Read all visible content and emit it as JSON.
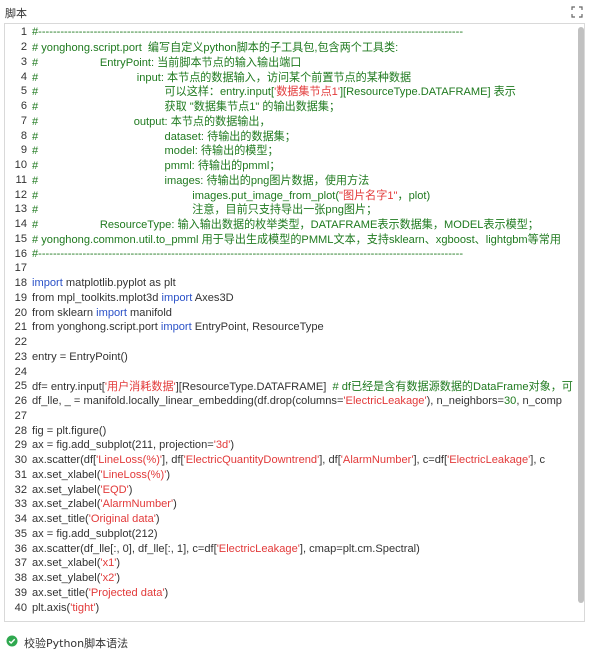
{
  "panel": {
    "title": "脚本",
    "expand_icon": "expand-icon",
    "validate_label": "校验Python脚本语法",
    "validate_icon": "check-circle-icon"
  },
  "colors": {
    "comment": "#1f7a1f",
    "keyword": "#2a51c7",
    "string": "#e23a3a",
    "number": "#1e7b1e",
    "text": "#333333"
  },
  "lines": [
    [
      {
        "t": "#-------------------------------------------------------------------------------------------------------------------",
        "c": "cm"
      }
    ],
    [
      {
        "t": "# yonghong.script.port  编写自定义python脚本的子工具包,包含两个工具类:",
        "c": "cm"
      }
    ],
    [
      {
        "t": "#                    EntryPoint: 当前脚本节点的输入输出端口",
        "c": "cm"
      }
    ],
    [
      {
        "t": "#                                input: 本节点的数据输入，访问某个前置节点的某种数据",
        "c": "cm"
      }
    ],
    [
      {
        "t": "#                                         可以这样：entry.input[",
        "c": "cm"
      },
      {
        "t": "'数据集节点1'",
        "c": "str"
      },
      {
        "t": "][ResourceType.DATAFRAME] 表示",
        "c": "cm"
      }
    ],
    [
      {
        "t": "#                                         获取 \"数据集节点1\" 的输出数据集；",
        "c": "cm"
      }
    ],
    [
      {
        "t": "#                               output: 本节点的数据输出，",
        "c": "cm"
      }
    ],
    [
      {
        "t": "#                                         dataset: 待输出的数据集；",
        "c": "cm"
      }
    ],
    [
      {
        "t": "#                                         model: 待输出的模型；",
        "c": "cm"
      }
    ],
    [
      {
        "t": "#                                         pmml: 待输出的pmml；",
        "c": "cm"
      }
    ],
    [
      {
        "t": "#                                         images: 待输出的png图片数据，使用方法",
        "c": "cm"
      }
    ],
    [
      {
        "t": "#                                                  images.put_image_from_plot(",
        "c": "cm"
      },
      {
        "t": "\"图片名字1\"",
        "c": "str"
      },
      {
        "t": "，plot)",
        "c": "cm"
      }
    ],
    [
      {
        "t": "#                                                  注意，目前只支持导出一张png图片；",
        "c": "cm"
      }
    ],
    [
      {
        "t": "#                    ResourceType: 输入输出数据的枚举类型，DATAFRAME表示数据集，MODEL表示模型；",
        "c": "cm"
      }
    ],
    [
      {
        "t": "# yonghong.common.util.to_pmml 用于导出生成模型的PMML文本，支持sklearn、xgboost、lightgbm等常用",
        "c": "cm"
      }
    ],
    [
      {
        "t": "#-------------------------------------------------------------------------------------------------------------------",
        "c": "cm"
      }
    ],
    [],
    [
      {
        "t": "import",
        "c": "kw"
      },
      {
        "t": " matplotlib.pyplot as plt"
      }
    ],
    [
      {
        "t": "from mpl_toolkits.mplot3d "
      },
      {
        "t": "import",
        "c": "kw"
      },
      {
        "t": " Axes3D"
      }
    ],
    [
      {
        "t": "from sklearn "
      },
      {
        "t": "import",
        "c": "kw"
      },
      {
        "t": " manifold"
      }
    ],
    [
      {
        "t": "from yonghong.script.port "
      },
      {
        "t": "import",
        "c": "kw"
      },
      {
        "t": " EntryPoint, ResourceType"
      }
    ],
    [],
    [
      {
        "t": "entry = EntryPoint()"
      }
    ],
    [],
    [
      {
        "t": "df= entry.input["
      },
      {
        "t": "'用户消耗数据'",
        "c": "str"
      },
      {
        "t": "][ResourceType.DATAFRAME]  "
      },
      {
        "t": "# df已经是含有数据源数据的DataFrame对象，可",
        "c": "cm"
      }
    ],
    [
      {
        "t": "df_lle, _ = manifold.locally_linear_embedding(df.drop(columns="
      },
      {
        "t": "'ElectricLeakage'",
        "c": "str"
      },
      {
        "t": "), n_neighbors="
      },
      {
        "t": "30",
        "c": "num"
      },
      {
        "t": ", n_comp"
      }
    ],
    [],
    [
      {
        "t": "fig = plt.figure()"
      }
    ],
    [
      {
        "t": "ax = fig.add_subplot(211, projection="
      },
      {
        "t": "'3d'",
        "c": "str"
      },
      {
        "t": ")"
      }
    ],
    [
      {
        "t": "ax.scatter(df["
      },
      {
        "t": "'LineLoss(%)'",
        "c": "str"
      },
      {
        "t": "], df["
      },
      {
        "t": "'ElectricQuantityDowntrend'",
        "c": "str"
      },
      {
        "t": "], df["
      },
      {
        "t": "'AlarmNumber'",
        "c": "str"
      },
      {
        "t": "], c=df["
      },
      {
        "t": "'ElectricLeakage'",
        "c": "str"
      },
      {
        "t": "], c"
      }
    ],
    [
      {
        "t": "ax.set_xlabel("
      },
      {
        "t": "'LineLoss(%)'",
        "c": "str"
      },
      {
        "t": ")"
      }
    ],
    [
      {
        "t": "ax.set_ylabel("
      },
      {
        "t": "'EQD'",
        "c": "str"
      },
      {
        "t": ")"
      }
    ],
    [
      {
        "t": "ax.set_zlabel("
      },
      {
        "t": "'AlarmNumber'",
        "c": "str"
      },
      {
        "t": ")"
      }
    ],
    [
      {
        "t": "ax.set_title("
      },
      {
        "t": "'Original data'",
        "c": "str"
      },
      {
        "t": ")"
      }
    ],
    [
      {
        "t": "ax = fig.add_subplot(212)"
      }
    ],
    [
      {
        "t": "ax.scatter(df_lle[:, 0], df_lle[:, 1], c=df["
      },
      {
        "t": "'ElectricLeakage'",
        "c": "str"
      },
      {
        "t": "], cmap=plt.cm.Spectral)"
      }
    ],
    [
      {
        "t": "ax.set_xlabel("
      },
      {
        "t": "'x1'",
        "c": "str"
      },
      {
        "t": ")"
      }
    ],
    [
      {
        "t": "ax.set_ylabel("
      },
      {
        "t": "'x2'",
        "c": "str"
      },
      {
        "t": ")"
      }
    ],
    [
      {
        "t": "ax.set_title("
      },
      {
        "t": "'Projected data'",
        "c": "str"
      },
      {
        "t": ")"
      }
    ],
    [
      {
        "t": "plt.axis("
      },
      {
        "t": "'tight'",
        "c": "str"
      },
      {
        "t": ")"
      }
    ]
  ]
}
